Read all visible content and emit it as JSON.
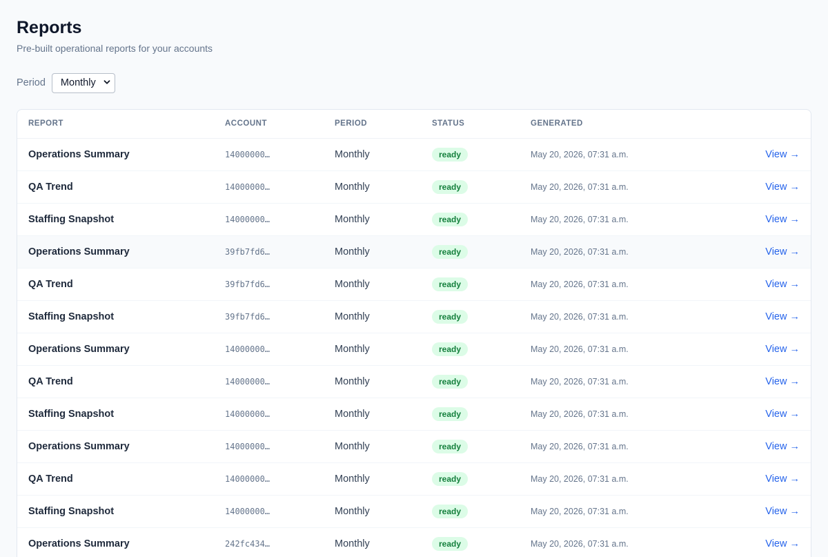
{
  "header": {
    "title": "Reports",
    "subtitle": "Pre-built operational reports for your accounts"
  },
  "filter": {
    "label": "Period",
    "selected": "Monthly"
  },
  "table": {
    "columns": [
      "REPORT",
      "ACCOUNT",
      "PERIOD",
      "STATUS",
      "GENERATED",
      ""
    ],
    "rows": [
      {
        "report": "Operations Summary",
        "account": "14000000…",
        "period": "Monthly",
        "status": "ready",
        "generated": "May 20, 2026, 07:31 a.m.",
        "action": "View →"
      },
      {
        "report": "QA Trend",
        "account": "14000000…",
        "period": "Monthly",
        "status": "ready",
        "generated": "May 20, 2026, 07:31 a.m.",
        "action": "View →"
      },
      {
        "report": "Staffing Snapshot",
        "account": "14000000…",
        "period": "Monthly",
        "status": "ready",
        "generated": "May 20, 2026, 07:31 a.m.",
        "action": "View →"
      },
      {
        "report": "Operations Summary",
        "account": "39fb7fd6…",
        "period": "Monthly",
        "status": "ready",
        "generated": "May 20, 2026, 07:31 a.m.",
        "action": "View →"
      },
      {
        "report": "QA Trend",
        "account": "39fb7fd6…",
        "period": "Monthly",
        "status": "ready",
        "generated": "May 20, 2026, 07:31 a.m.",
        "action": "View →"
      },
      {
        "report": "Staffing Snapshot",
        "account": "39fb7fd6…",
        "period": "Monthly",
        "status": "ready",
        "generated": "May 20, 2026, 07:31 a.m.",
        "action": "View →"
      },
      {
        "report": "Operations Summary",
        "account": "14000000…",
        "period": "Monthly",
        "status": "ready",
        "generated": "May 20, 2026, 07:31 a.m.",
        "action": "View →"
      },
      {
        "report": "QA Trend",
        "account": "14000000…",
        "period": "Monthly",
        "status": "ready",
        "generated": "May 20, 2026, 07:31 a.m.",
        "action": "View →"
      },
      {
        "report": "Staffing Snapshot",
        "account": "14000000…",
        "period": "Monthly",
        "status": "ready",
        "generated": "May 20, 2026, 07:31 a.m.",
        "action": "View →"
      },
      {
        "report": "Operations Summary",
        "account": "14000000…",
        "period": "Monthly",
        "status": "ready",
        "generated": "May 20, 2026, 07:31 a.m.",
        "action": "View →"
      },
      {
        "report": "QA Trend",
        "account": "14000000…",
        "period": "Monthly",
        "status": "ready",
        "generated": "May 20, 2026, 07:31 a.m.",
        "action": "View →"
      },
      {
        "report": "Staffing Snapshot",
        "account": "14000000…",
        "period": "Monthly",
        "status": "ready",
        "generated": "May 20, 2026, 07:31 a.m.",
        "action": "View →"
      },
      {
        "report": "Operations Summary",
        "account": "242fc434…",
        "period": "Monthly",
        "status": "ready",
        "generated": "May 20, 2026, 07:31 a.m.",
        "action": "View →"
      }
    ]
  },
  "colors": {
    "accent": "#2563eb",
    "status_ready_bg": "#dcfce7",
    "status_ready_text": "#15803d"
  },
  "icons": {
    "select": "chevron-down-icon"
  }
}
